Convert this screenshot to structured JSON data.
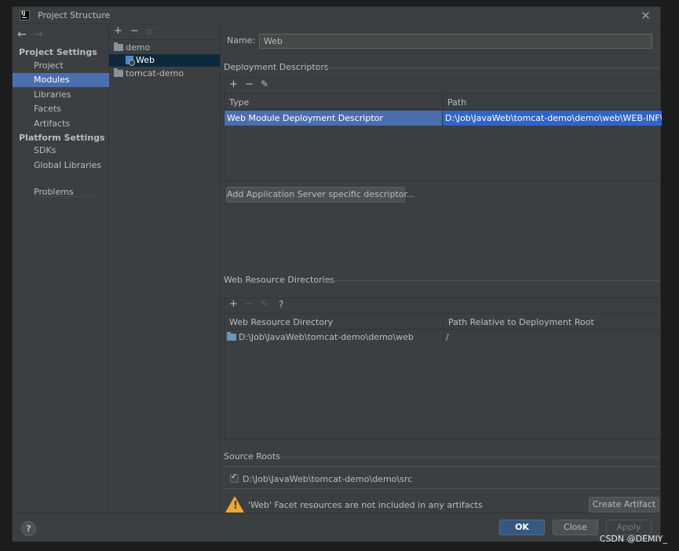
{
  "window": {
    "title": "Project Structure"
  },
  "nav": {
    "sections": [
      {
        "label": "Project Settings",
        "items": [
          "Project",
          "Modules",
          "Libraries",
          "Facets",
          "Artifacts"
        ]
      },
      {
        "label": "Platform Settings",
        "items": [
          "SDKs",
          "Global Libraries"
        ]
      }
    ],
    "problems": "Problems",
    "selected": "Modules"
  },
  "modules": {
    "tree": [
      {
        "label": "demo",
        "icon": "folder-icon",
        "level": 0
      },
      {
        "label": "Web",
        "icon": "web-facet-icon",
        "level": 1,
        "selected": true
      },
      {
        "label": "tomcat-demo",
        "icon": "folder-icon",
        "level": 0
      }
    ]
  },
  "form": {
    "name_label": "Name:",
    "name_value": "Web"
  },
  "deployment": {
    "title": "Deployment Descriptors",
    "headers": [
      "Type",
      "Path"
    ],
    "rows": [
      {
        "type": "Web Module Deployment Descriptor",
        "path": "D:\\Job\\JavaWeb\\tomcat-demo\\demo\\web\\WEB-INF\\web.xml"
      }
    ],
    "add_button": "Add Application Server specific descriptor..."
  },
  "web_resources": {
    "title": "Web Resource Directories",
    "headers": [
      "Web Resource Directory",
      "Path Relative to Deployment Root"
    ],
    "rows": [
      {
        "dir": "D:\\Job\\JavaWeb\\tomcat-demo\\demo\\web",
        "relpath": "/"
      }
    ]
  },
  "source_roots": {
    "title": "Source Roots",
    "items": [
      {
        "path": "D:\\Job\\JavaWeb\\tomcat-demo\\demo\\src",
        "checked": true
      }
    ]
  },
  "warning": {
    "text": "'Web' Facet resources are not included in any artifacts",
    "button": "Create Artifact"
  },
  "footer": {
    "help": "?",
    "ok": "OK",
    "close": "Close",
    "apply": "Apply"
  },
  "watermark": "CSDN @DEMIY_",
  "colors": {
    "selection": "#4b6eaf",
    "background": "#3c3f41",
    "warning": "#f0a732"
  }
}
